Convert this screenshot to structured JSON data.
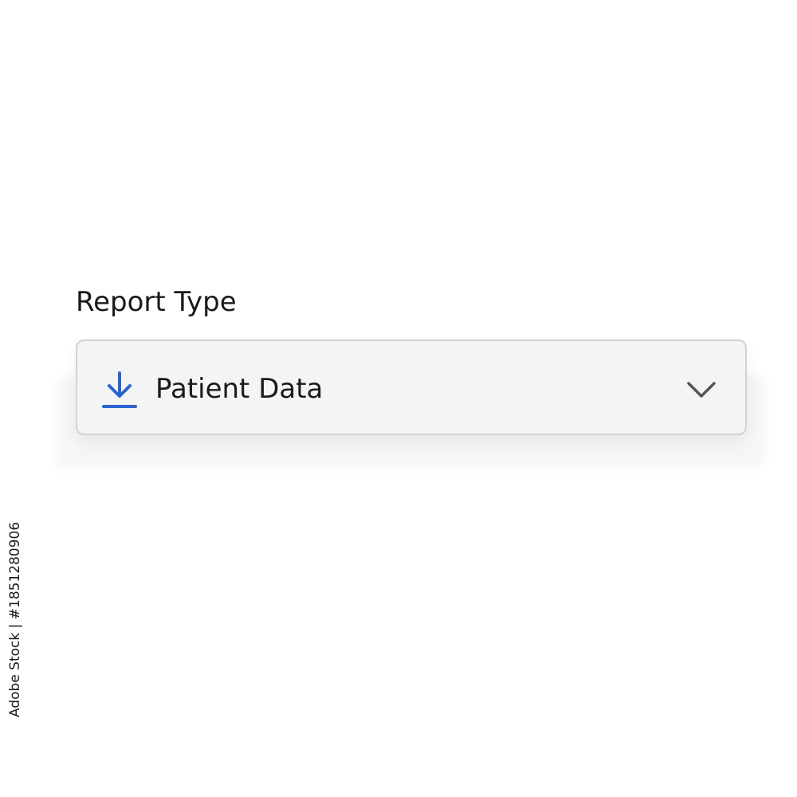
{
  "form": {
    "label": "Report Type",
    "select": {
      "value": "Patient Data",
      "leading_icon": "download-icon",
      "trailing_icon": "chevron-down-icon"
    }
  },
  "watermark": {
    "id_text": "Adobe Stock | #1851280906"
  },
  "colors": {
    "accent": "#2b64d0",
    "select_background": "#f4f4f4",
    "select_border": "#d2d2d2",
    "chevron": "#555555",
    "text": "#1a1a1a"
  }
}
